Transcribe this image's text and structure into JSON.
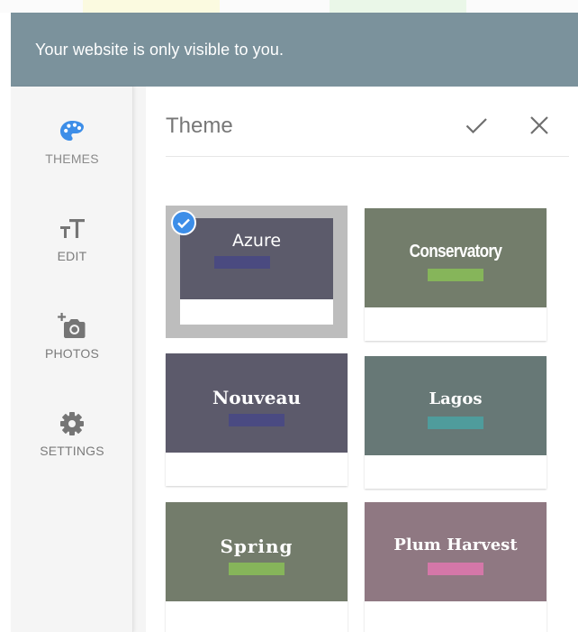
{
  "colors": {
    "banner_bg": "#7b929c",
    "accent": "#3d8ee8",
    "top_strip_yellow": "#fbfae0",
    "top_strip_green": "#eaf7e8"
  },
  "banner": {
    "text": "Your website is only visible to you."
  },
  "sidebar": {
    "items": [
      {
        "label": "THEMES",
        "icon": "palette-icon",
        "active": true
      },
      {
        "label": "EDIT",
        "icon": "text-size-icon",
        "active": false
      },
      {
        "label": "PHOTOS",
        "icon": "add-photo-icon",
        "active": false
      },
      {
        "label": "SETTINGS",
        "icon": "gear-icon",
        "active": false
      }
    ]
  },
  "panel": {
    "title": "Theme",
    "confirm_icon": "check-icon",
    "close_icon": "close-icon"
  },
  "themes": [
    {
      "name": "Azure",
      "bg": "#5c5b6b",
      "swatch": "#4a4a80",
      "selected": true
    },
    {
      "name": "Conservatory",
      "bg": "#737d6b",
      "swatch": "#86b55a",
      "selected": false
    },
    {
      "name": "Nouveau",
      "bg": "#5c5a6b",
      "swatch": "#4a4a82",
      "selected": false
    },
    {
      "name": "Lagos",
      "bg": "#677876",
      "swatch": "#4f9c9c",
      "selected": false
    },
    {
      "name": "Spring",
      "bg": "#737c6b",
      "swatch": "#86b55a",
      "selected": false
    },
    {
      "name": "Plum Harvest",
      "bg": "#8f7882",
      "swatch": "#d477a8",
      "selected": false
    }
  ]
}
